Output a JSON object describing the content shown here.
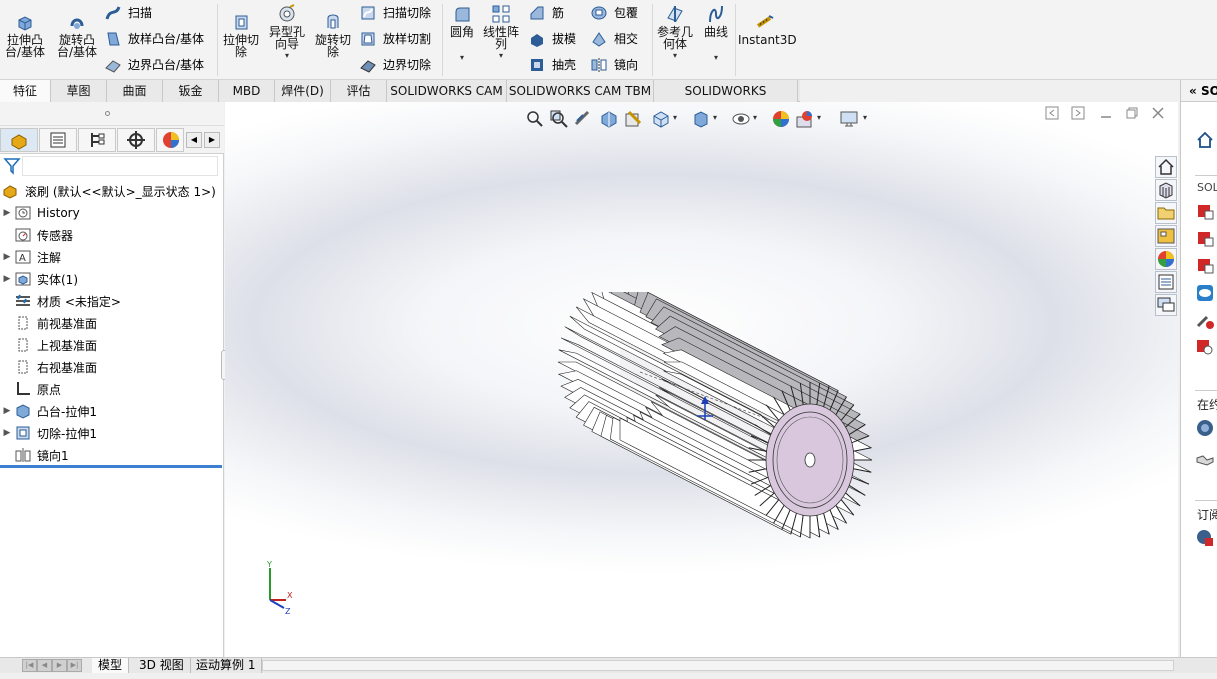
{
  "ribbon": {
    "extrude_boss": "拉伸凸\n台/基体",
    "revolve_boss": "旋转凸\n台/基体",
    "sweep": "扫描",
    "loft_boss": "放样凸台/基体",
    "boundary_boss": "边界凸台/基体",
    "extrude_cut": "拉伸切\n除",
    "hole_wizard": "异型孔\n向导",
    "revolve_cut": "旋转切\n除",
    "swept_cut": "扫描切除",
    "lofted_cut": "放样切割",
    "boundary_cut": "边界切除",
    "fillet": "圆角",
    "linear_pattern": "线性阵\n列",
    "rib": "筋",
    "draft": "拔模",
    "shell": "抽壳",
    "wrap": "包覆",
    "intersect": "相交",
    "mirror": "镜向",
    "ref_geometry": "参考几\n何体",
    "curves": "曲线",
    "instant3d": "Instant3D"
  },
  "tabs": [
    "特征",
    "草图",
    "曲面",
    "钣金",
    "MBD",
    "焊件(D)",
    "评估",
    "SOLIDWORKS CAM",
    "SOLIDWORKS CAM TBM",
    "SOLIDWORKS Inspection"
  ],
  "tree": {
    "root": "滚刷 (默认<<默认>_显示状态 1>)",
    "items": [
      "History",
      "传感器",
      "注解",
      "实体(1)",
      "材质 <未指定>",
      "前视基准面",
      "上视基准面",
      "右视基准面",
      "原点",
      "凸台-拉伸1",
      "切除-拉伸1",
      "镜向1"
    ]
  },
  "bottom_tabs": [
    "模型",
    "3D 视图",
    "运动算例 1"
  ],
  "taskpane": {
    "title_partial": "SO",
    "section1": "SOL",
    "section2": "在约",
    "section3": "订阅"
  },
  "triad_labels": {
    "y": "Y",
    "x": "X",
    "z": "Z"
  },
  "colors": {
    "accent_blue": "#1a6fb8",
    "face_pink": "#d9c7dd",
    "selection_blue": "#3d7fd0"
  }
}
